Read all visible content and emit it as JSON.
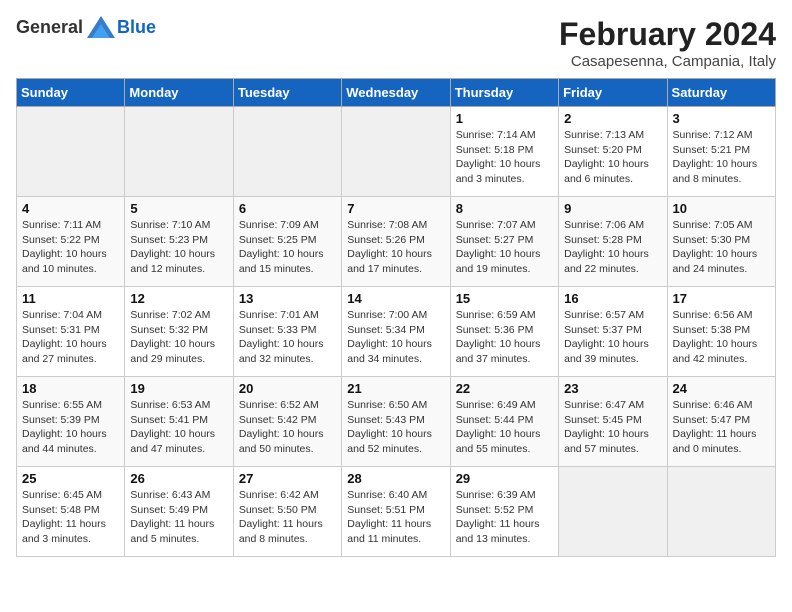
{
  "logo": {
    "general": "General",
    "blue": "Blue"
  },
  "title": "February 2024",
  "subtitle": "Casapesenna, Campania, Italy",
  "weekdays": [
    "Sunday",
    "Monday",
    "Tuesday",
    "Wednesday",
    "Thursday",
    "Friday",
    "Saturday"
  ],
  "weeks": [
    [
      {
        "day": "",
        "info": ""
      },
      {
        "day": "",
        "info": ""
      },
      {
        "day": "",
        "info": ""
      },
      {
        "day": "",
        "info": ""
      },
      {
        "day": "1",
        "info": "Sunrise: 7:14 AM\nSunset: 5:18 PM\nDaylight: 10 hours\nand 3 minutes."
      },
      {
        "day": "2",
        "info": "Sunrise: 7:13 AM\nSunset: 5:20 PM\nDaylight: 10 hours\nand 6 minutes."
      },
      {
        "day": "3",
        "info": "Sunrise: 7:12 AM\nSunset: 5:21 PM\nDaylight: 10 hours\nand 8 minutes."
      }
    ],
    [
      {
        "day": "4",
        "info": "Sunrise: 7:11 AM\nSunset: 5:22 PM\nDaylight: 10 hours\nand 10 minutes."
      },
      {
        "day": "5",
        "info": "Sunrise: 7:10 AM\nSunset: 5:23 PM\nDaylight: 10 hours\nand 12 minutes."
      },
      {
        "day": "6",
        "info": "Sunrise: 7:09 AM\nSunset: 5:25 PM\nDaylight: 10 hours\nand 15 minutes."
      },
      {
        "day": "7",
        "info": "Sunrise: 7:08 AM\nSunset: 5:26 PM\nDaylight: 10 hours\nand 17 minutes."
      },
      {
        "day": "8",
        "info": "Sunrise: 7:07 AM\nSunset: 5:27 PM\nDaylight: 10 hours\nand 19 minutes."
      },
      {
        "day": "9",
        "info": "Sunrise: 7:06 AM\nSunset: 5:28 PM\nDaylight: 10 hours\nand 22 minutes."
      },
      {
        "day": "10",
        "info": "Sunrise: 7:05 AM\nSunset: 5:30 PM\nDaylight: 10 hours\nand 24 minutes."
      }
    ],
    [
      {
        "day": "11",
        "info": "Sunrise: 7:04 AM\nSunset: 5:31 PM\nDaylight: 10 hours\nand 27 minutes."
      },
      {
        "day": "12",
        "info": "Sunrise: 7:02 AM\nSunset: 5:32 PM\nDaylight: 10 hours\nand 29 minutes."
      },
      {
        "day": "13",
        "info": "Sunrise: 7:01 AM\nSunset: 5:33 PM\nDaylight: 10 hours\nand 32 minutes."
      },
      {
        "day": "14",
        "info": "Sunrise: 7:00 AM\nSunset: 5:34 PM\nDaylight: 10 hours\nand 34 minutes."
      },
      {
        "day": "15",
        "info": "Sunrise: 6:59 AM\nSunset: 5:36 PM\nDaylight: 10 hours\nand 37 minutes."
      },
      {
        "day": "16",
        "info": "Sunrise: 6:57 AM\nSunset: 5:37 PM\nDaylight: 10 hours\nand 39 minutes."
      },
      {
        "day": "17",
        "info": "Sunrise: 6:56 AM\nSunset: 5:38 PM\nDaylight: 10 hours\nand 42 minutes."
      }
    ],
    [
      {
        "day": "18",
        "info": "Sunrise: 6:55 AM\nSunset: 5:39 PM\nDaylight: 10 hours\nand 44 minutes."
      },
      {
        "day": "19",
        "info": "Sunrise: 6:53 AM\nSunset: 5:41 PM\nDaylight: 10 hours\nand 47 minutes."
      },
      {
        "day": "20",
        "info": "Sunrise: 6:52 AM\nSunset: 5:42 PM\nDaylight: 10 hours\nand 50 minutes."
      },
      {
        "day": "21",
        "info": "Sunrise: 6:50 AM\nSunset: 5:43 PM\nDaylight: 10 hours\nand 52 minutes."
      },
      {
        "day": "22",
        "info": "Sunrise: 6:49 AM\nSunset: 5:44 PM\nDaylight: 10 hours\nand 55 minutes."
      },
      {
        "day": "23",
        "info": "Sunrise: 6:47 AM\nSunset: 5:45 PM\nDaylight: 10 hours\nand 57 minutes."
      },
      {
        "day": "24",
        "info": "Sunrise: 6:46 AM\nSunset: 5:47 PM\nDaylight: 11 hours\nand 0 minutes."
      }
    ],
    [
      {
        "day": "25",
        "info": "Sunrise: 6:45 AM\nSunset: 5:48 PM\nDaylight: 11 hours\nand 3 minutes."
      },
      {
        "day": "26",
        "info": "Sunrise: 6:43 AM\nSunset: 5:49 PM\nDaylight: 11 hours\nand 5 minutes."
      },
      {
        "day": "27",
        "info": "Sunrise: 6:42 AM\nSunset: 5:50 PM\nDaylight: 11 hours\nand 8 minutes."
      },
      {
        "day": "28",
        "info": "Sunrise: 6:40 AM\nSunset: 5:51 PM\nDaylight: 11 hours\nand 11 minutes."
      },
      {
        "day": "29",
        "info": "Sunrise: 6:39 AM\nSunset: 5:52 PM\nDaylight: 11 hours\nand 13 minutes."
      },
      {
        "day": "",
        "info": ""
      },
      {
        "day": "",
        "info": ""
      }
    ]
  ]
}
